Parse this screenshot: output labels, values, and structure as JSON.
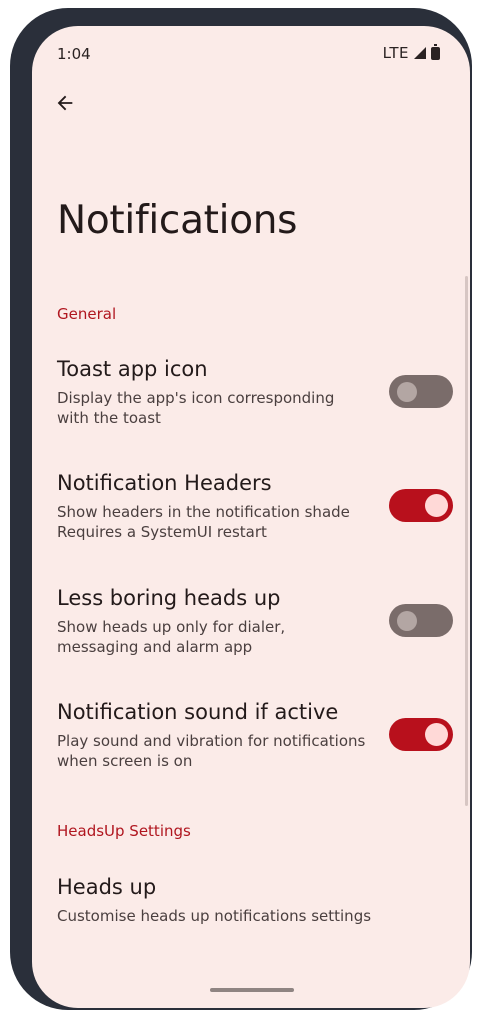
{
  "status_bar": {
    "time": "1:04",
    "network": "LTE",
    "signal_icon": "signal-icon",
    "battery_icon": "battery-icon"
  },
  "header": {
    "back_icon": "arrow-back-icon",
    "title": "Notifications"
  },
  "sections": [
    {
      "header": "General"
    },
    {
      "header": "HeadsUp Settings"
    }
  ],
  "prefs": [
    {
      "title": "Toast app icon",
      "summary": "Display the app's icon corresponding with the toast",
      "enabled": false
    },
    {
      "title": "Notification Headers",
      "summary": "Show headers in the notification shade Requires a SystemUI restart",
      "enabled": true
    },
    {
      "title": "Less boring heads up",
      "summary": "Show heads up only for dialer, messaging and alarm app",
      "enabled": false
    },
    {
      "title": "Notification sound if active",
      "summary": "Play sound and vibration for notifications when screen is on",
      "enabled": true
    },
    {
      "title": "Heads up",
      "summary": "Customise heads up notifications settings"
    }
  ],
  "colors": {
    "accent": "#b8101c",
    "background": "#fbebe8",
    "switch_off": "#7a6c6a"
  }
}
